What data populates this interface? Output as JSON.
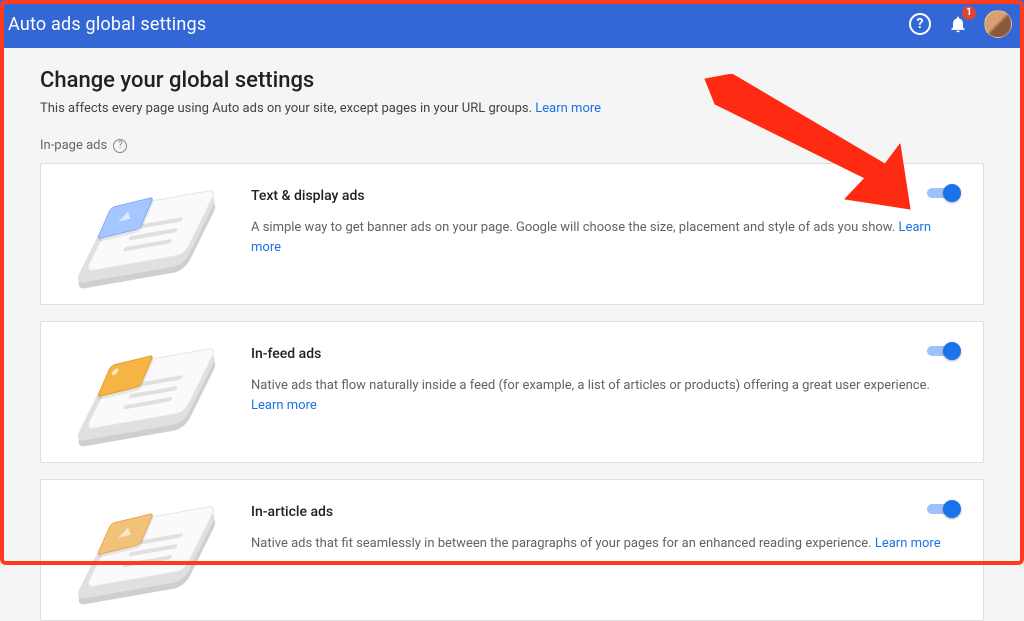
{
  "header": {
    "title": "Auto ads global settings",
    "notification_count": "1"
  },
  "page": {
    "heading": "Change your global settings",
    "subtitle_text": "This affects every page using Auto ads on your site, except pages in your URL groups. ",
    "subtitle_link": "Learn more",
    "section_label": "In-page ads"
  },
  "cards": [
    {
      "title": "Text & display ads",
      "desc": "A simple way to get banner ads on your page. Google will choose the size, placement and style of ads you show. ",
      "learn_more": "Learn more",
      "chip_color": "blue",
      "enabled": true
    },
    {
      "title": "In-feed ads",
      "desc": "Native ads that flow naturally inside a feed (for example, a list of articles or products) offering a great user experience. ",
      "learn_more": "Learn more",
      "chip_color": "orange",
      "enabled": true
    },
    {
      "title": "In-article ads",
      "desc": "Native ads that fit seamlessly in between the paragraphs of your pages for an enhanced reading experience. ",
      "learn_more": "Learn more",
      "chip_color": "orange2",
      "enabled": true
    }
  ]
}
